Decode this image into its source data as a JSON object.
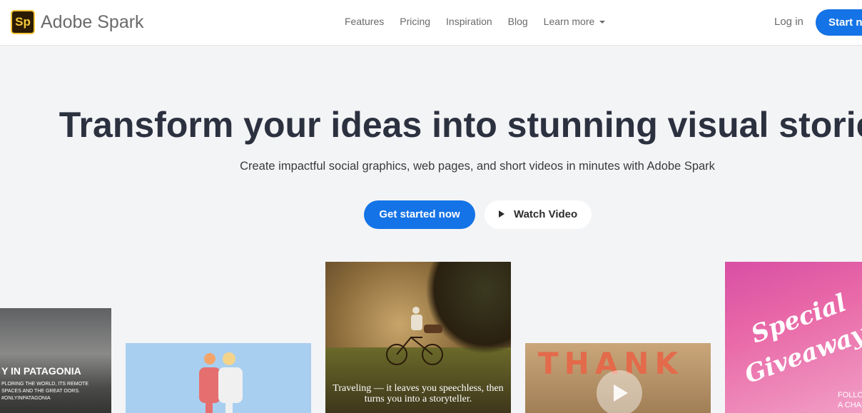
{
  "brand": {
    "logo_text": "Sp",
    "name": "Adobe Spark"
  },
  "nav": {
    "links": [
      "Features",
      "Pricing",
      "Inspiration",
      "Blog"
    ],
    "dropdown": "Learn more",
    "login": "Log in",
    "start": "Start now"
  },
  "hero": {
    "title": "Transform your ideas into stunning visual stories",
    "subtitle": "Create impactful social graphics, web pages, and short videos in minutes with Adobe Spark",
    "primary_button": "Get started now",
    "secondary_button": "Watch Video"
  },
  "cards": {
    "patagonia_title": "Y IN PATAGONIA",
    "patagonia_text": "PLORING THE WORLD, ITS REMOTE SPACES AND THE GREAT OORS. #ONLYINPATAGONIA",
    "travel_quote": "Traveling — it leaves you speechless, then turns you into a storyteller.",
    "thank_text": "THANK",
    "special_text": "Special",
    "giveaway_text": "Giveaway",
    "follow_text": "FOLLOW",
    "chance_text": "A CHAN"
  },
  "colors": {
    "accent": "#1473e6",
    "logo_bg": "#2b1b02",
    "logo_fg": "#f5c73a"
  }
}
